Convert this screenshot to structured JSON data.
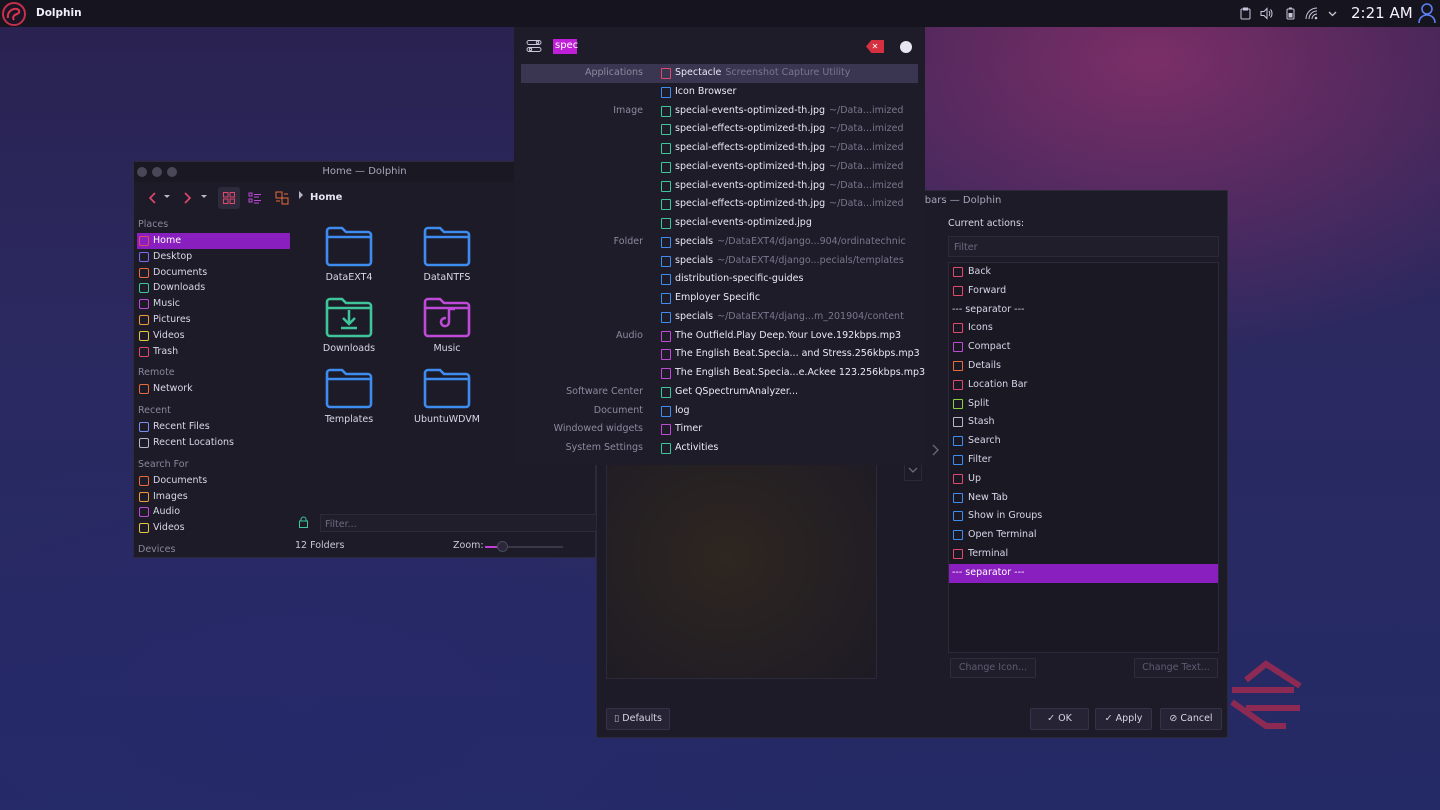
{
  "top_panel": {
    "app_name": "Dolphin",
    "clock": "2:21 AM",
    "tray_icons": [
      "clipboard-icon",
      "volume-icon",
      "battery-icon",
      "wifi-icon",
      "chevron-down-icon"
    ]
  },
  "dolphin_main": {
    "title": "Home — Dolphin",
    "breadcrumb": "Home",
    "places": [
      {
        "type": "group",
        "label": "Places"
      },
      {
        "type": "item",
        "label": "Home",
        "icon": "home-icon",
        "color": "#e0486c",
        "selected": true
      },
      {
        "type": "item",
        "label": "Desktop",
        "icon": "desktop-icon",
        "color": "#7b6cf0"
      },
      {
        "type": "item",
        "label": "Documents",
        "icon": "documents-icon",
        "color": "#e86b3a"
      },
      {
        "type": "item",
        "label": "Downloads",
        "icon": "downloads-icon",
        "color": "#3fc59a"
      },
      {
        "type": "item",
        "label": "Music",
        "icon": "music-icon",
        "color": "#c04ad8"
      },
      {
        "type": "item",
        "label": "Pictures",
        "icon": "pictures-icon",
        "color": "#f09b3a"
      },
      {
        "type": "item",
        "label": "Videos",
        "icon": "videos-icon",
        "color": "#e8c43a"
      },
      {
        "type": "item",
        "label": "Trash",
        "icon": "trash-icon",
        "color": "#e0486c"
      },
      {
        "type": "gap"
      },
      {
        "type": "group",
        "label": "Remote"
      },
      {
        "type": "item",
        "label": "Network",
        "icon": "network-icon",
        "color": "#e86b3a"
      },
      {
        "type": "gap"
      },
      {
        "type": "group",
        "label": "Recent"
      },
      {
        "type": "item",
        "label": "Recent Files",
        "icon": "recent-files-icon",
        "color": "#7b8cf0"
      },
      {
        "type": "item",
        "label": "Recent Locations",
        "icon": "recent-locations-icon",
        "color": "#b9b6ca"
      },
      {
        "type": "gap"
      },
      {
        "type": "group",
        "label": "Search For"
      },
      {
        "type": "item",
        "label": "Documents",
        "icon": "documents-icon",
        "color": "#e86b3a"
      },
      {
        "type": "item",
        "label": "Images",
        "icon": "images-icon",
        "color": "#f09b3a"
      },
      {
        "type": "item",
        "label": "Audio",
        "icon": "audio-icon",
        "color": "#c04ad8"
      },
      {
        "type": "item",
        "label": "Videos",
        "icon": "videos-icon",
        "color": "#e8c43a"
      },
      {
        "type": "gap"
      },
      {
        "type": "group",
        "label": "Devices"
      }
    ],
    "folders": [
      {
        "label": "DataEXT4",
        "icon": "folder-icon",
        "color": "#3f8cf0"
      },
      {
        "label": "DataNTFS",
        "icon": "folder-icon",
        "color": "#3f8cf0"
      },
      {
        "label": "Downloads",
        "icon": "folder-downloads-icon",
        "color": "#3fc59a"
      },
      {
        "label": "Music",
        "icon": "folder-music-icon",
        "color": "#c04ad8"
      },
      {
        "label": "Templates",
        "icon": "folder-icon",
        "color": "#3f8cf0"
      },
      {
        "label": "UbuntuWDVM",
        "icon": "folder-icon",
        "color": "#3f8cf0"
      }
    ],
    "filter_placeholder": "Filter...",
    "status": "12 Folders",
    "zoom_label": "Zoom:",
    "zoom_fraction": 0.18
  },
  "toolbar_config": {
    "title_partial": "lbars — Dolphin",
    "current_actions_label": "Current actions:",
    "filter_placeholder": "Filter",
    "actions": [
      {
        "label": "Back",
        "icon": "chevron-left-icon",
        "color": "#e0486c"
      },
      {
        "label": "Forward",
        "icon": "chevron-right-icon",
        "color": "#e0486c"
      },
      {
        "label": "--- separator ---",
        "icon": "",
        "color": ""
      },
      {
        "label": "Icons",
        "icon": "icons-view-icon",
        "color": "#e0486c"
      },
      {
        "label": "Compact",
        "icon": "compact-view-icon",
        "color": "#c04ad8"
      },
      {
        "label": "Details",
        "icon": "details-view-icon",
        "color": "#e86b3a"
      },
      {
        "label": "Location Bar",
        "icon": "location-bar-icon",
        "color": "#e0486c"
      },
      {
        "label": "Split",
        "icon": "split-icon",
        "color": "#8ad03f"
      },
      {
        "label": "Stash",
        "icon": "stash-icon",
        "color": "#b9b6ca"
      },
      {
        "label": "Search",
        "icon": "search-icon",
        "color": "#3f8cf0"
      },
      {
        "label": "Filter",
        "icon": "filter-icon",
        "color": "#3f8cf0"
      },
      {
        "label": "Up",
        "icon": "chevron-up-icon",
        "color": "#e0486c"
      },
      {
        "label": "New Tab",
        "icon": "new-tab-icon",
        "color": "#3f8cf0"
      },
      {
        "label": "Show in Groups",
        "icon": "groups-icon",
        "color": "#3f8cf0"
      },
      {
        "label": "Open Terminal",
        "icon": "terminal-icon",
        "color": "#3f8cf0"
      },
      {
        "label": "Terminal",
        "icon": "terminal-icon",
        "color": "#e0486c"
      },
      {
        "label": "--- separator ---",
        "icon": "",
        "color": "",
        "selected": true
      }
    ],
    "change_icon": "Change Icon...",
    "change_text": "Change Text...",
    "defaults": "Defaults",
    "ok": "OK",
    "apply": "Apply",
    "cancel": "Cancel"
  },
  "krunner": {
    "query": "spec",
    "results": [
      {
        "category": "Applications",
        "name": "Spectacle",
        "sub": "Screenshot Capture Utility",
        "icon": "spectacle-icon",
        "color": "#e0486c",
        "selected": true
      },
      {
        "category": "",
        "name": "Icon Browser",
        "sub": "",
        "icon": "icon-browser-icon",
        "color": "#3f8cf0"
      },
      {
        "category": "Image",
        "name": "special-events-optimized-th.jpg",
        "sub": "~/Data...imized",
        "icon": "image-file-icon",
        "color": "#3fc59a"
      },
      {
        "category": "",
        "name": "special-effects-optimized-th.jpg",
        "sub": "~/Data...imized",
        "icon": "image-file-icon",
        "color": "#3fc59a"
      },
      {
        "category": "",
        "name": "special-effects-optimized-th.jpg",
        "sub": "~/Data...imized",
        "icon": "image-file-icon",
        "color": "#3fc59a"
      },
      {
        "category": "",
        "name": "special-events-optimized-th.jpg",
        "sub": "~/Data...imized",
        "icon": "image-file-icon",
        "color": "#3fc59a"
      },
      {
        "category": "",
        "name": "special-events-optimized-th.jpg",
        "sub": "~/Data...imized",
        "icon": "image-file-icon",
        "color": "#3fc59a"
      },
      {
        "category": "",
        "name": "special-effects-optimized-th.jpg",
        "sub": "~/Data...imized",
        "icon": "image-file-icon",
        "color": "#3fc59a"
      },
      {
        "category": "",
        "name": "special-events-optimized.jpg",
        "sub": "",
        "icon": "image-file-icon",
        "color": "#3fc59a"
      },
      {
        "category": "Folder",
        "name": "specials",
        "sub": "~/DataEXT4/django...904/ordinatechnic",
        "icon": "folder-icon",
        "color": "#3f8cf0"
      },
      {
        "category": "",
        "name": "specials",
        "sub": "~/DataEXT4/django...pecials/templates",
        "icon": "folder-icon",
        "color": "#3f8cf0"
      },
      {
        "category": "",
        "name": "distribution-specific-guides",
        "sub": "",
        "icon": "folder-icon",
        "color": "#3f8cf0"
      },
      {
        "category": "",
        "name": "Employer Specific",
        "sub": "",
        "icon": "folder-icon",
        "color": "#3f8cf0"
      },
      {
        "category": "",
        "name": "specials",
        "sub": "~/DataEXT4/djang...m_201904/content",
        "icon": "folder-icon",
        "color": "#3f8cf0"
      },
      {
        "category": "Audio",
        "name": "The Outfield.Play Deep.Your Love.192kbps.mp3",
        "sub": "",
        "icon": "audio-file-icon",
        "color": "#c04ad8"
      },
      {
        "category": "",
        "name": "The English Beat.Specia... and Stress.256kbps.mp3",
        "sub": "",
        "icon": "audio-file-icon",
        "color": "#c04ad8"
      },
      {
        "category": "",
        "name": "The English Beat.Specia...e.Ackee 123.256kbps.mp3",
        "sub": "",
        "icon": "audio-file-icon",
        "color": "#c04ad8"
      },
      {
        "category": "Software Center",
        "name": "Get QSpectrumAnalyzer...",
        "sub": "",
        "icon": "software-center-icon",
        "color": "#3fc59a"
      },
      {
        "category": "Document",
        "name": "log",
        "sub": "",
        "icon": "document-icon",
        "color": "#3f8cf0"
      },
      {
        "category": "Windowed widgets",
        "name": "Timer",
        "sub": "",
        "icon": "timer-icon",
        "color": "#c04ad8"
      },
      {
        "category": "System Settings",
        "name": "Activities",
        "sub": "",
        "icon": "activities-icon",
        "color": "#3fc59a"
      }
    ]
  }
}
